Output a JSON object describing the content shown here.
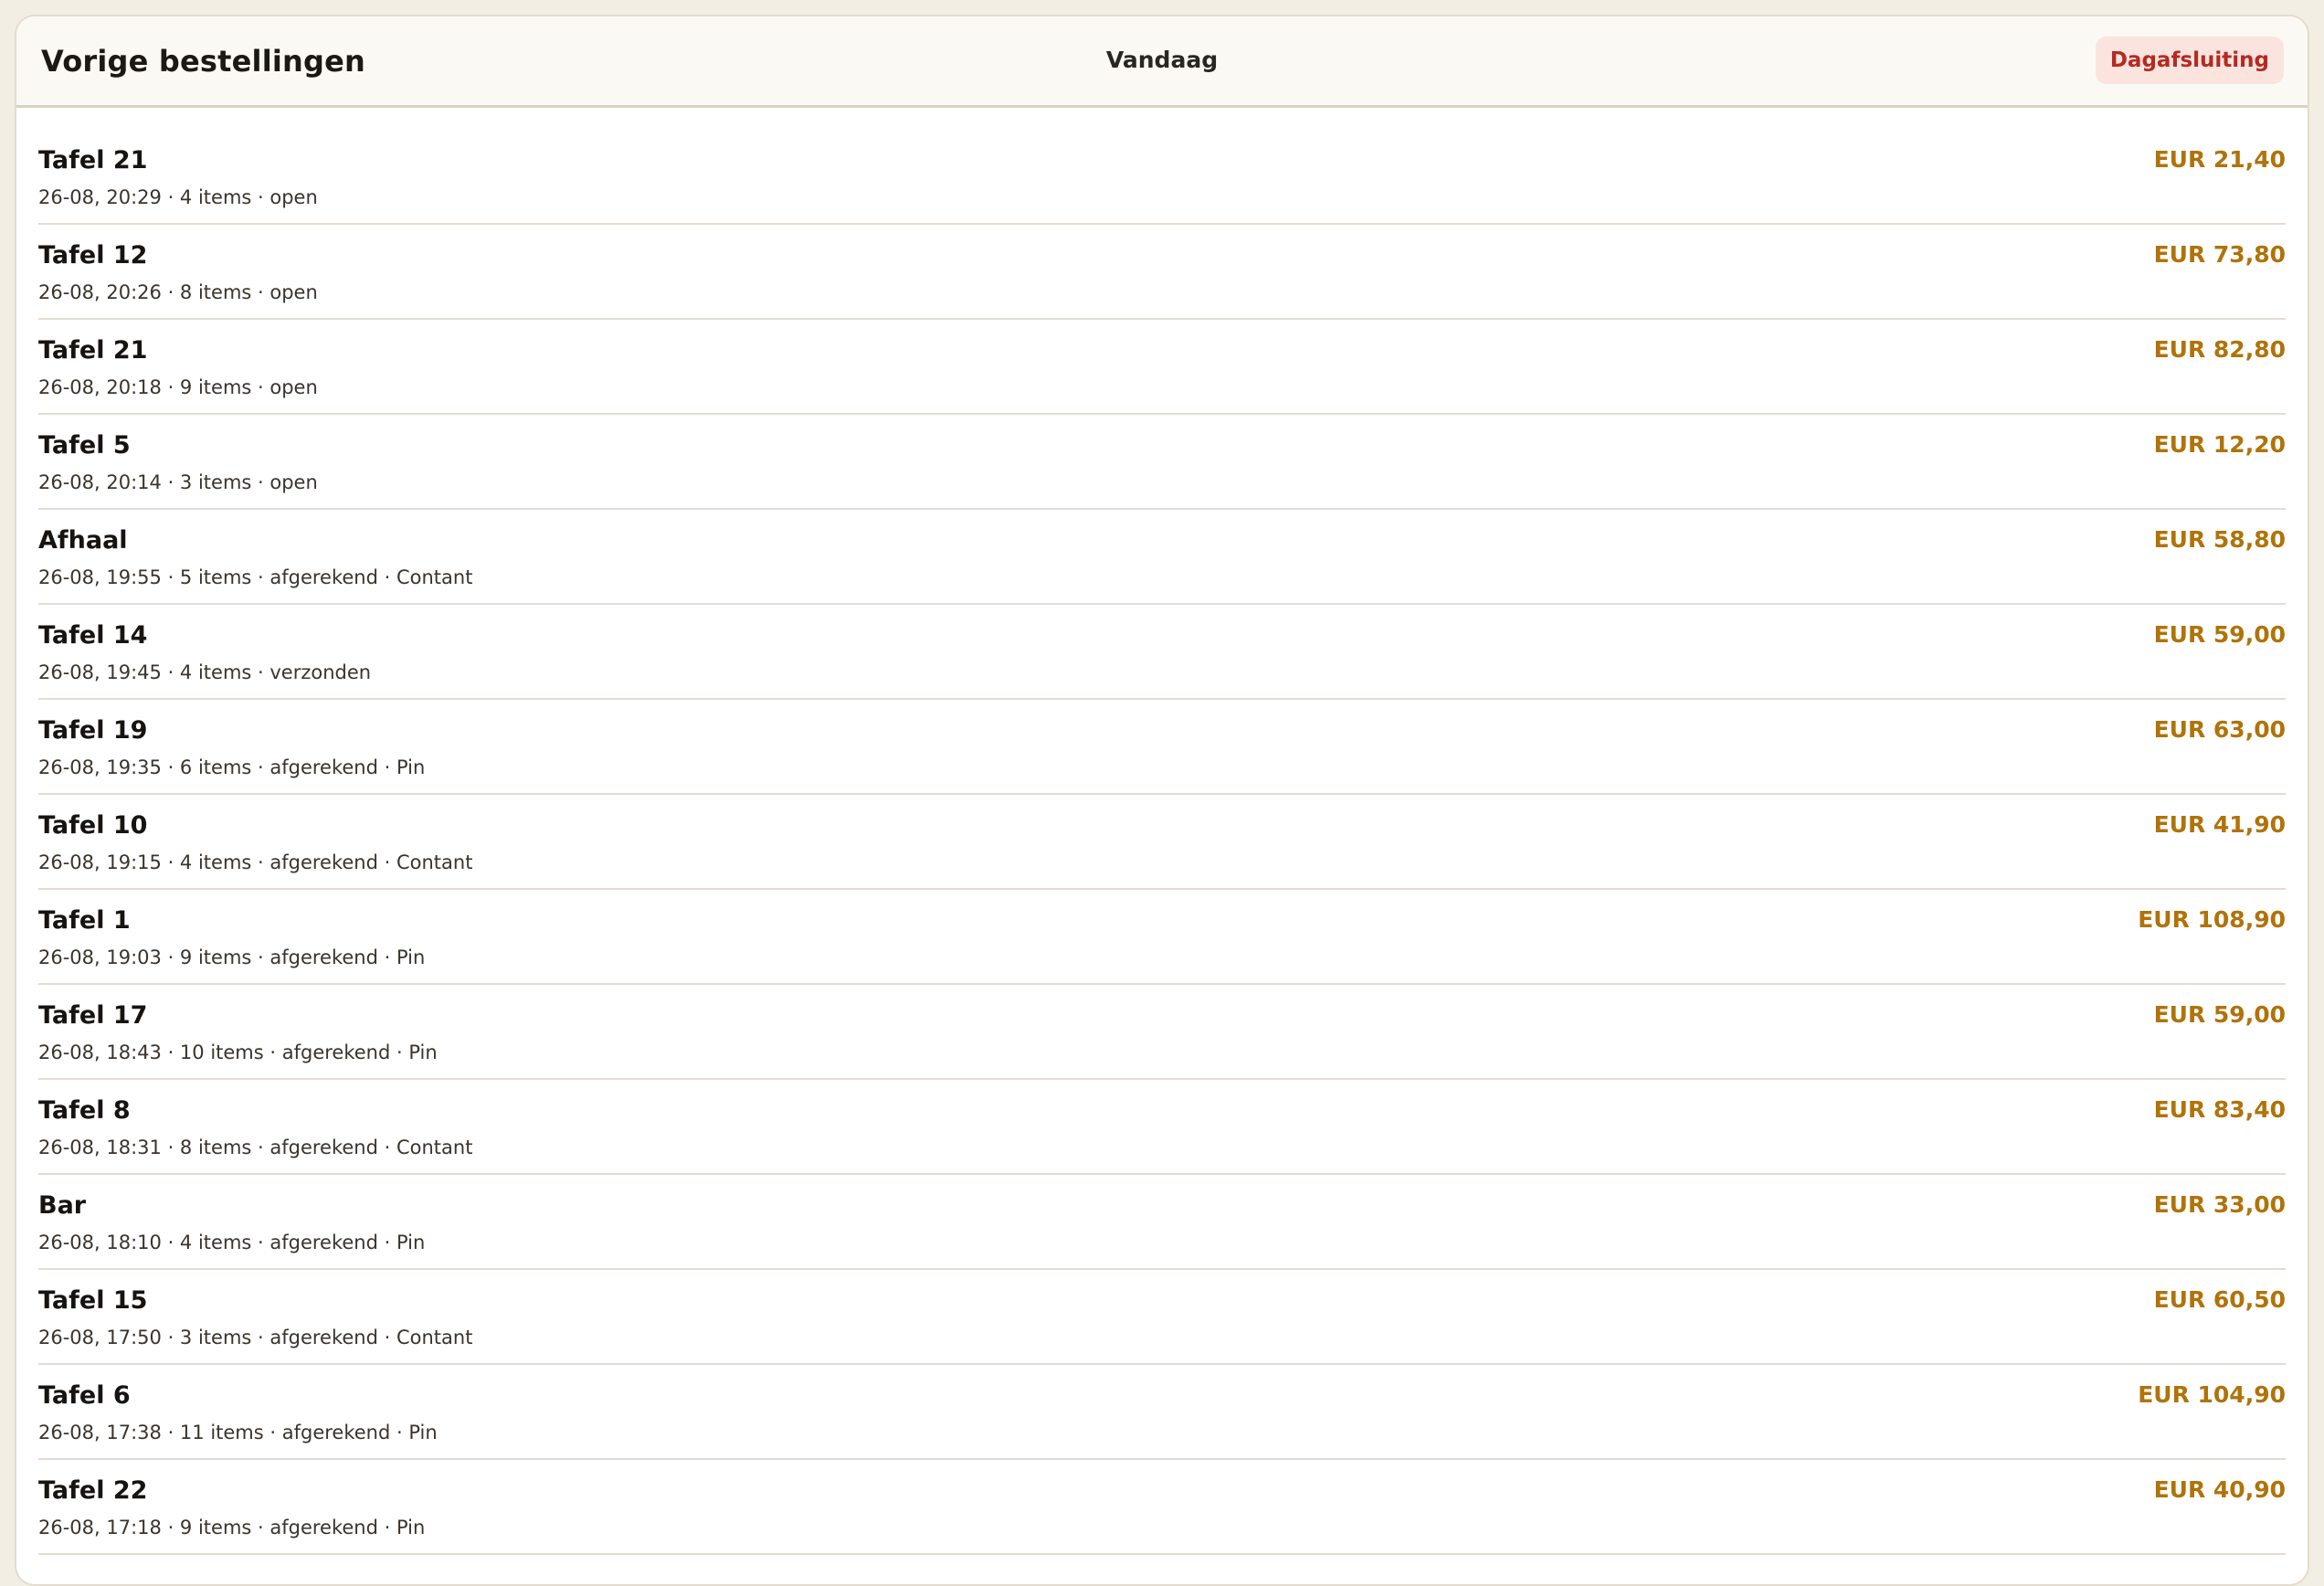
{
  "header": {
    "title": "Vorige bestellingen",
    "filter_label": "Vandaag",
    "close_day_label": "Dagafsluiting"
  },
  "colors": {
    "accent_total": "#b0730a",
    "danger": "#b42a22",
    "danger_bg": "#fbe3de",
    "page_bg": "#f3eee3"
  },
  "orders": [
    {
      "name": "Tafel 21",
      "meta": "26-08, 20:29 · 4 items · open",
      "total": "EUR 21,40"
    },
    {
      "name": "Tafel 12",
      "meta": "26-08, 20:26 · 8 items · open",
      "total": "EUR 73,80"
    },
    {
      "name": "Tafel 21",
      "meta": "26-08, 20:18 · 9 items · open",
      "total": "EUR 82,80"
    },
    {
      "name": "Tafel 5",
      "meta": "26-08, 20:14 · 3 items · open",
      "total": "EUR 12,20"
    },
    {
      "name": "Afhaal",
      "meta": "26-08, 19:55 · 5 items · afgerekend · Contant",
      "total": "EUR 58,80"
    },
    {
      "name": "Tafel 14",
      "meta": "26-08, 19:45 · 4 items · verzonden",
      "total": "EUR 59,00"
    },
    {
      "name": "Tafel 19",
      "meta": "26-08, 19:35 · 6 items · afgerekend · Pin",
      "total": "EUR 63,00"
    },
    {
      "name": "Tafel 10",
      "meta": "26-08, 19:15 · 4 items · afgerekend · Contant",
      "total": "EUR 41,90"
    },
    {
      "name": "Tafel 1",
      "meta": "26-08, 19:03 · 9 items · afgerekend · Pin",
      "total": "EUR 108,90"
    },
    {
      "name": "Tafel 17",
      "meta": "26-08, 18:43 · 10 items · afgerekend · Pin",
      "total": "EUR 59,00"
    },
    {
      "name": "Tafel 8",
      "meta": "26-08, 18:31 · 8 items · afgerekend · Contant",
      "total": "EUR 83,40"
    },
    {
      "name": "Bar",
      "meta": "26-08, 18:10 · 4 items · afgerekend · Pin",
      "total": "EUR 33,00"
    },
    {
      "name": "Tafel 15",
      "meta": "26-08, 17:50 · 3 items · afgerekend · Contant",
      "total": "EUR 60,50"
    },
    {
      "name": "Tafel 6",
      "meta": "26-08, 17:38 · 11 items · afgerekend · Pin",
      "total": "EUR 104,90"
    },
    {
      "name": "Tafel 22",
      "meta": "26-08, 17:18 · 9 items · afgerekend · Pin",
      "total": "EUR 40,90"
    }
  ]
}
